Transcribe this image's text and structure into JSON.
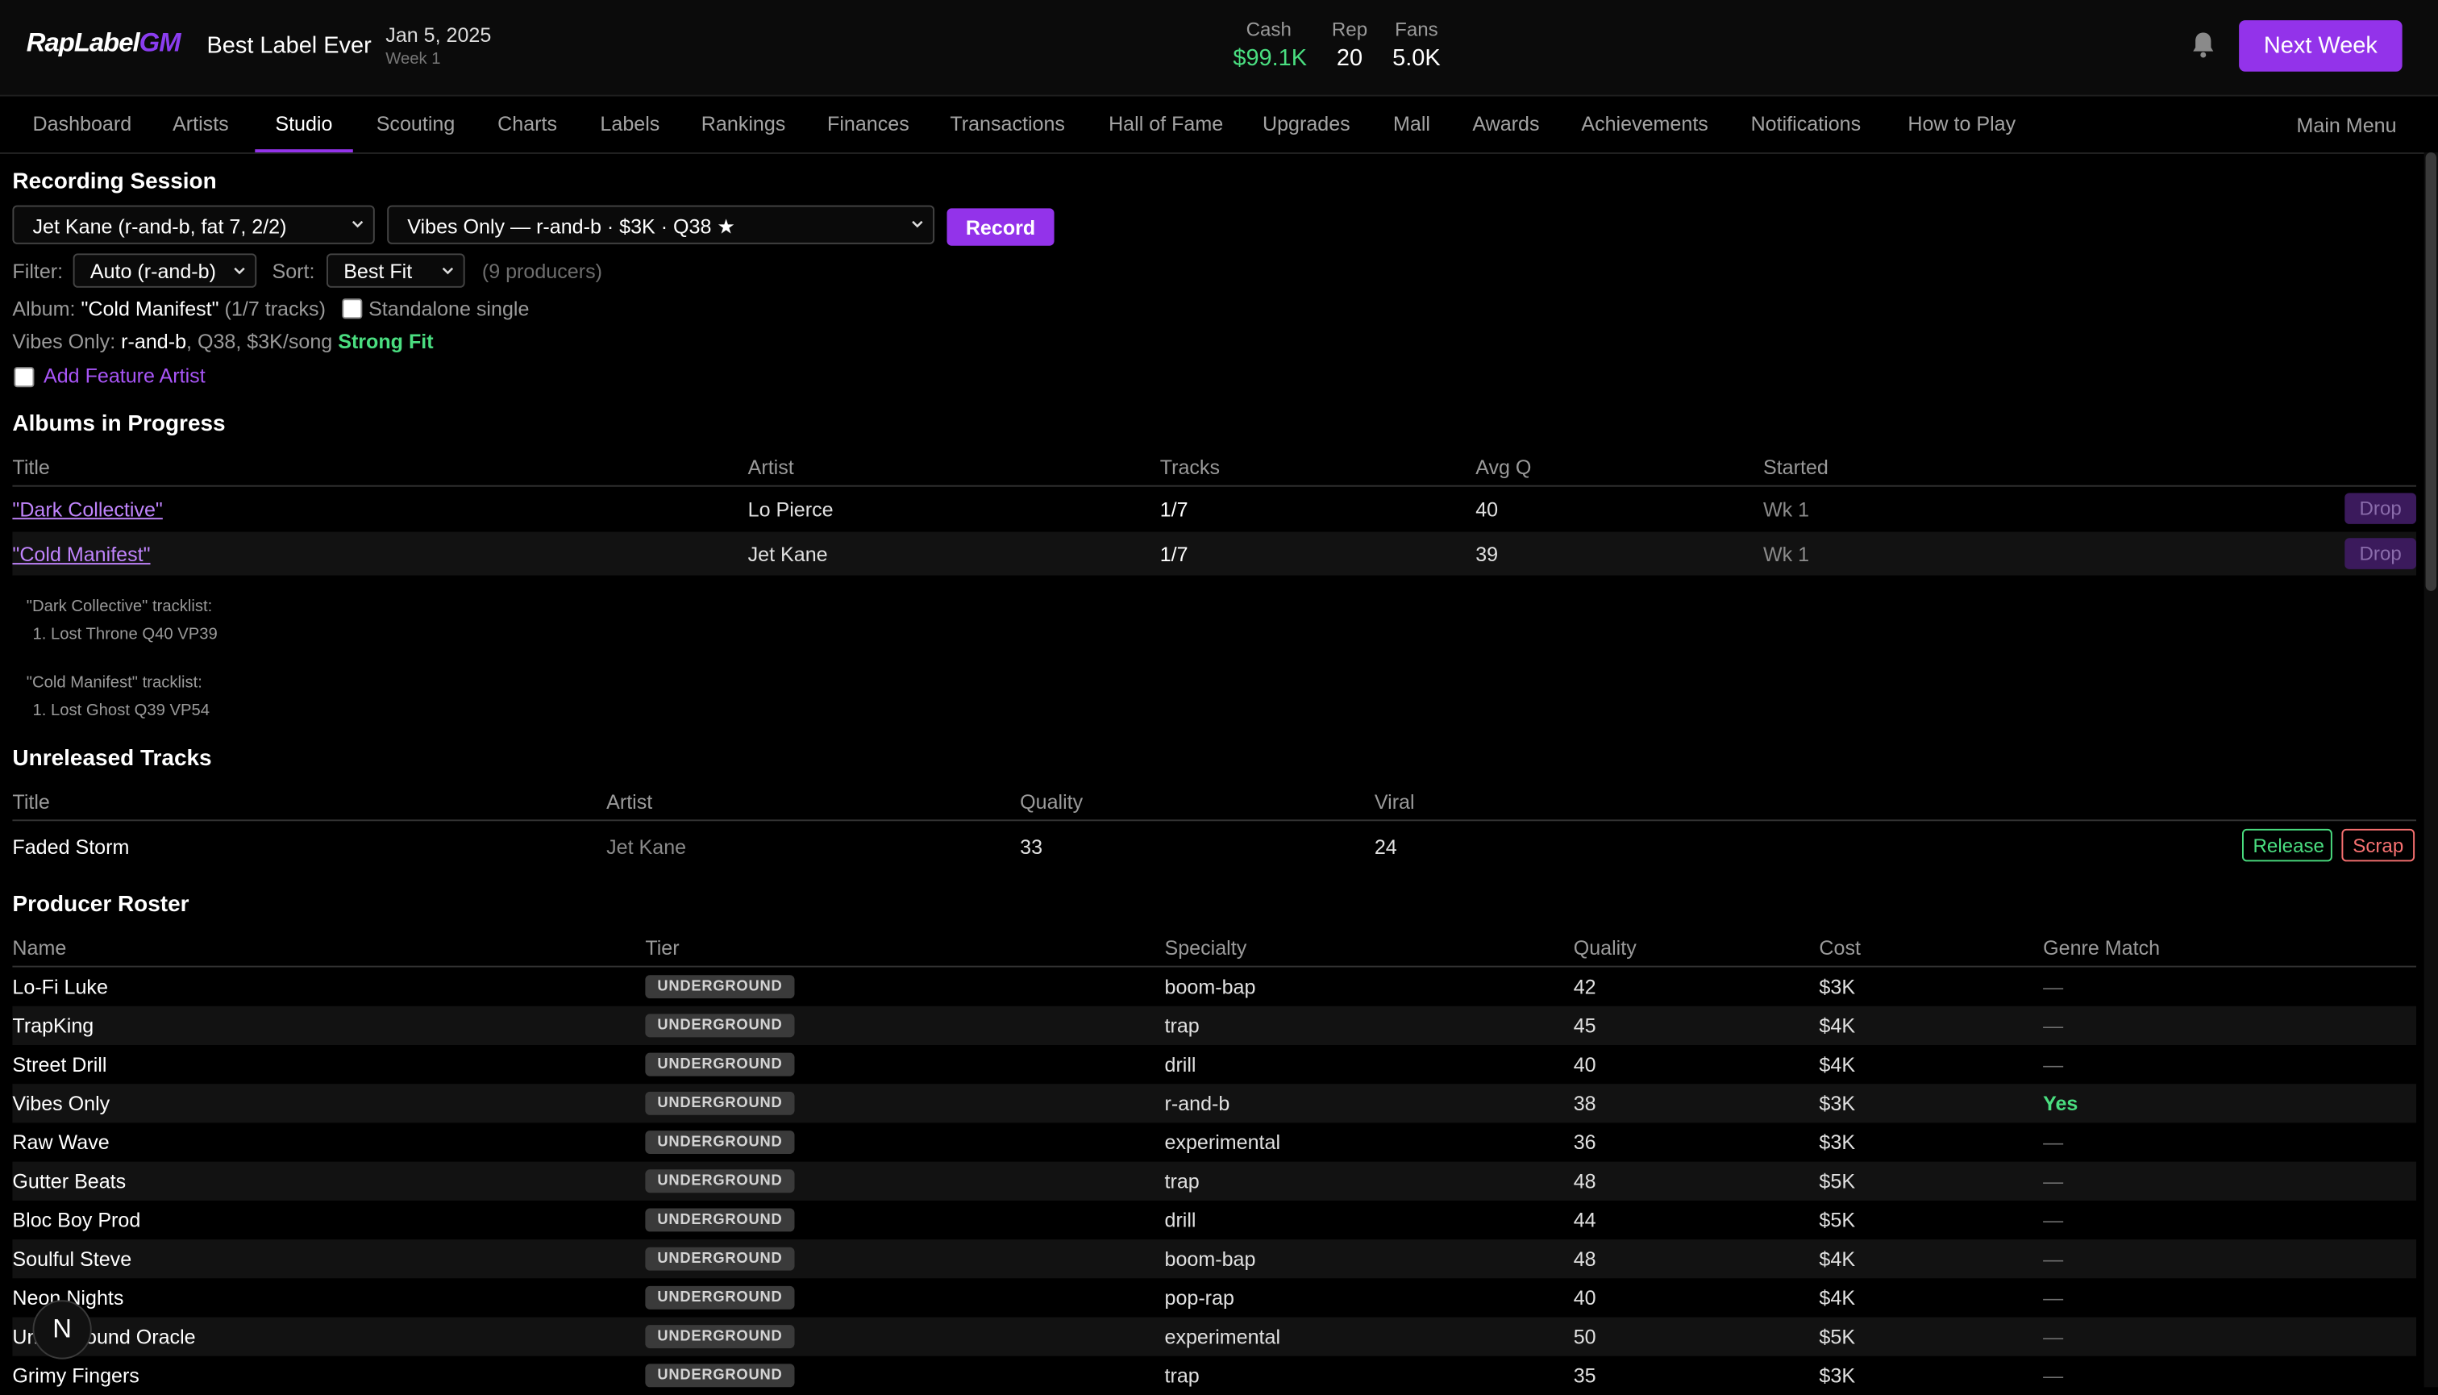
{
  "header": {
    "logo_main": "RapLabel",
    "logo_accent": "GM",
    "label_name": "Best Label Ever",
    "date": "Jan 5, 2025",
    "week": "Week 1",
    "stats": [
      {
        "key": "Cash",
        "value": "$99.1K",
        "accent": "#4ade80"
      },
      {
        "key": "Rep",
        "value": "20"
      },
      {
        "key": "Fans",
        "value": "5.0K"
      }
    ],
    "bell_icon": "bell-icon",
    "next_week_label": "Next Week"
  },
  "nav": {
    "items": [
      "Dashboard",
      "Artists",
      "Studio",
      "Scouting",
      "Charts",
      "Labels",
      "Rankings",
      "Finances",
      "Transactions",
      "Hall of Fame",
      "Upgrades",
      "Mall",
      "Awards",
      "Achievements",
      "Notifications",
      "How to Play"
    ],
    "active": "Studio",
    "main_menu": "Main Menu"
  },
  "recording": {
    "title": "Recording Session",
    "artist_select": "Jet Kane (r-and-b, fat 7, 2/2)",
    "producer_select": "Vibes Only — r-and-b · $3K · Q38 ★",
    "record_label": "Record",
    "filter_label": "Filter:",
    "filter_value": "Auto (r-and-b)",
    "sort_label": "Sort:",
    "sort_value": "Best Fit",
    "producer_count": "(9 producers)",
    "album_label": "Album:",
    "album_name": "\"Cold Manifest\"",
    "album_tracks": "(1/7 tracks)",
    "standalone_label": "Standalone single",
    "vibes_name": "Vibes Only:",
    "vibes_genre": "r-and-b",
    "vibes_details": ", Q38, $3K/song",
    "fit": "Strong Fit",
    "feature_label": "Add Feature Artist"
  },
  "albums": {
    "title": "Albums in Progress",
    "headers": [
      "Title",
      "Artist",
      "Tracks",
      "Avg Q",
      "Started"
    ],
    "rows": [
      {
        "title": "\"Dark Collective\"",
        "artist": "Lo Pierce",
        "tracks": "1/7",
        "avgq": "40",
        "started": "Wk 1",
        "action": "Drop"
      },
      {
        "title": "\"Cold Manifest\"",
        "artist": "Jet Kane",
        "tracks": "1/7",
        "avgq": "39",
        "started": "Wk 1",
        "action": "Drop"
      }
    ],
    "tracklists": [
      {
        "heading": "\"Dark Collective\" tracklist:",
        "items": [
          "1. Lost Throne Q40 VP39"
        ]
      },
      {
        "heading": "\"Cold Manifest\" tracklist:",
        "items": [
          "1. Lost Ghost Q39 VP54"
        ]
      }
    ]
  },
  "unreleased": {
    "title": "Unreleased Tracks",
    "headers": [
      "Title",
      "Artist",
      "Quality",
      "Viral"
    ],
    "rows": [
      {
        "title": "Faded Storm",
        "artist": "Jet Kane",
        "quality": "33",
        "viral": "24",
        "release": "Release",
        "scrap": "Scrap"
      }
    ]
  },
  "producers": {
    "title": "Producer Roster",
    "headers": [
      "Name",
      "Tier",
      "Specialty",
      "Quality",
      "Cost",
      "Genre Match"
    ],
    "rows": [
      {
        "name": "Lo-Fi Luke",
        "tier": "UNDERGROUND",
        "specialty": "boom-bap",
        "quality": "42",
        "cost": "$3K",
        "match": "—"
      },
      {
        "name": "TrapKing",
        "tier": "UNDERGROUND",
        "specialty": "trap",
        "quality": "45",
        "cost": "$4K",
        "match": "—"
      },
      {
        "name": "Street Drill",
        "tier": "UNDERGROUND",
        "specialty": "drill",
        "quality": "40",
        "cost": "$4K",
        "match": "—"
      },
      {
        "name": "Vibes Only",
        "tier": "UNDERGROUND",
        "specialty": "r-and-b",
        "quality": "38",
        "cost": "$3K",
        "match": "Yes"
      },
      {
        "name": "Raw Wave",
        "tier": "UNDERGROUND",
        "specialty": "experimental",
        "quality": "36",
        "cost": "$3K",
        "match": "—"
      },
      {
        "name": "Gutter Beats",
        "tier": "UNDERGROUND",
        "specialty": "trap",
        "quality": "48",
        "cost": "$5K",
        "match": "—"
      },
      {
        "name": "Bloc Boy Prod",
        "tier": "UNDERGROUND",
        "specialty": "drill",
        "quality": "44",
        "cost": "$5K",
        "match": "—"
      },
      {
        "name": "Soulful Steve",
        "tier": "UNDERGROUND",
        "specialty": "boom-bap",
        "quality": "48",
        "cost": "$4K",
        "match": "—"
      },
      {
        "name": "Neon Nights",
        "tier": "UNDERGROUND",
        "specialty": "pop-rap",
        "quality": "40",
        "cost": "$4K",
        "match": "—"
      },
      {
        "name": "Underground Oracle",
        "tier": "UNDERGROUND",
        "specialty": "experimental",
        "quality": "50",
        "cost": "$5K",
        "match": "—"
      },
      {
        "name": "Grimy Fingers",
        "tier": "UNDERGROUND",
        "specialty": "trap",
        "quality": "35",
        "cost": "$3K",
        "match": "—"
      }
    ]
  },
  "floating_badge": "N",
  "colors": {
    "accent": "#9333ea",
    "positive": "#4ade80",
    "danger": "#f87171",
    "link": "#c084fc"
  }
}
